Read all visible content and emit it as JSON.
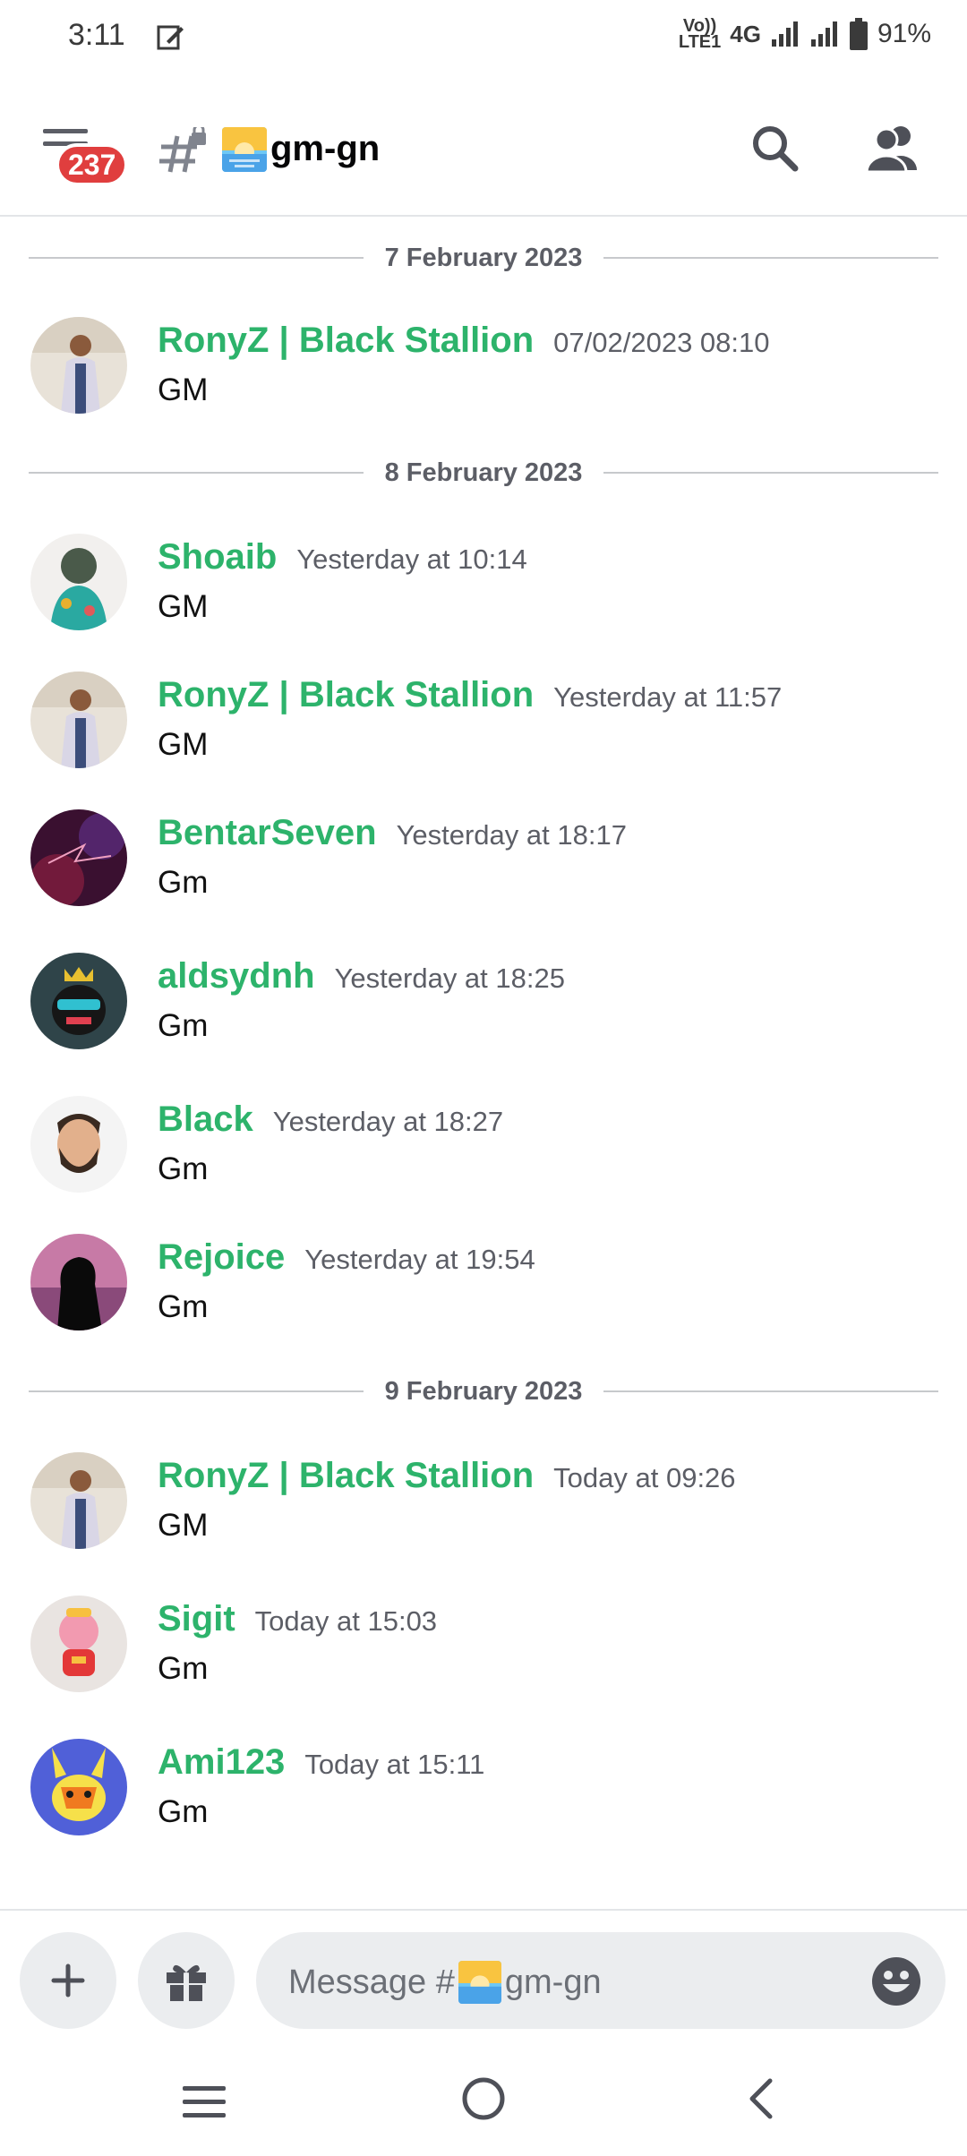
{
  "status_bar": {
    "time": "3:11",
    "network_small_top": "Vo))",
    "network_small_bottom": "LTE1",
    "network_type": "4G",
    "battery": "91%"
  },
  "header": {
    "unread_badge": "237",
    "channel_name": "gm-gn"
  },
  "messages": [
    {
      "type": "divider",
      "text": "7 February 2023"
    },
    {
      "type": "message",
      "author": "RonyZ | Black Stallion",
      "time": "07/02/2023 08:10",
      "text": "GM",
      "avatar": "suit-man"
    },
    {
      "type": "divider",
      "text": "8 February 2023"
    },
    {
      "type": "message",
      "author": "Shoaib",
      "time": "Yesterday at 10:14",
      "text": "GM",
      "avatar": "astronaut"
    },
    {
      "type": "message",
      "author": "RonyZ | Black Stallion",
      "time": "Yesterday at 11:57",
      "text": "GM",
      "avatar": "suit-man"
    },
    {
      "type": "message",
      "author": "BentarSeven",
      "time": "Yesterday at 18:17",
      "text": "Gm",
      "avatar": "purple-logo"
    },
    {
      "type": "message",
      "author": "aldsydnh",
      "time": "Yesterday at 18:25",
      "text": "Gm",
      "avatar": "crowned-character"
    },
    {
      "type": "message",
      "author": "Black",
      "time": "Yesterday at 18:27",
      "text": "Gm",
      "avatar": "bearded-man"
    },
    {
      "type": "message",
      "author": "Rejoice",
      "time": "Yesterday at 19:54",
      "text": "Gm",
      "avatar": "silhouette"
    },
    {
      "type": "divider",
      "text": "9 February 2023"
    },
    {
      "type": "message",
      "author": "RonyZ | Black Stallion",
      "time": "Today at 09:26",
      "text": "GM",
      "avatar": "suit-man"
    },
    {
      "type": "message",
      "author": "Sigit",
      "time": "Today at 15:03",
      "text": "Gm",
      "avatar": "pink-toy"
    },
    {
      "type": "message",
      "author": "Ami123",
      "time": "Today at 15:11",
      "text": "Gm",
      "avatar": "yellow-character"
    }
  ],
  "input": {
    "placeholder_prefix": "Message #",
    "placeholder_channel": "gm-gn"
  },
  "colors": {
    "username": "#2db36b",
    "badge": "#e03e3e",
    "field_bg": "#ebedef"
  },
  "icons": [
    "menu-icon",
    "channel-locked-hash-icon",
    "sunrise-emoji",
    "search-icon",
    "members-icon",
    "plus-icon",
    "gift-icon",
    "emoji-icon",
    "nav-recents-icon",
    "nav-home-icon",
    "nav-back-icon"
  ]
}
